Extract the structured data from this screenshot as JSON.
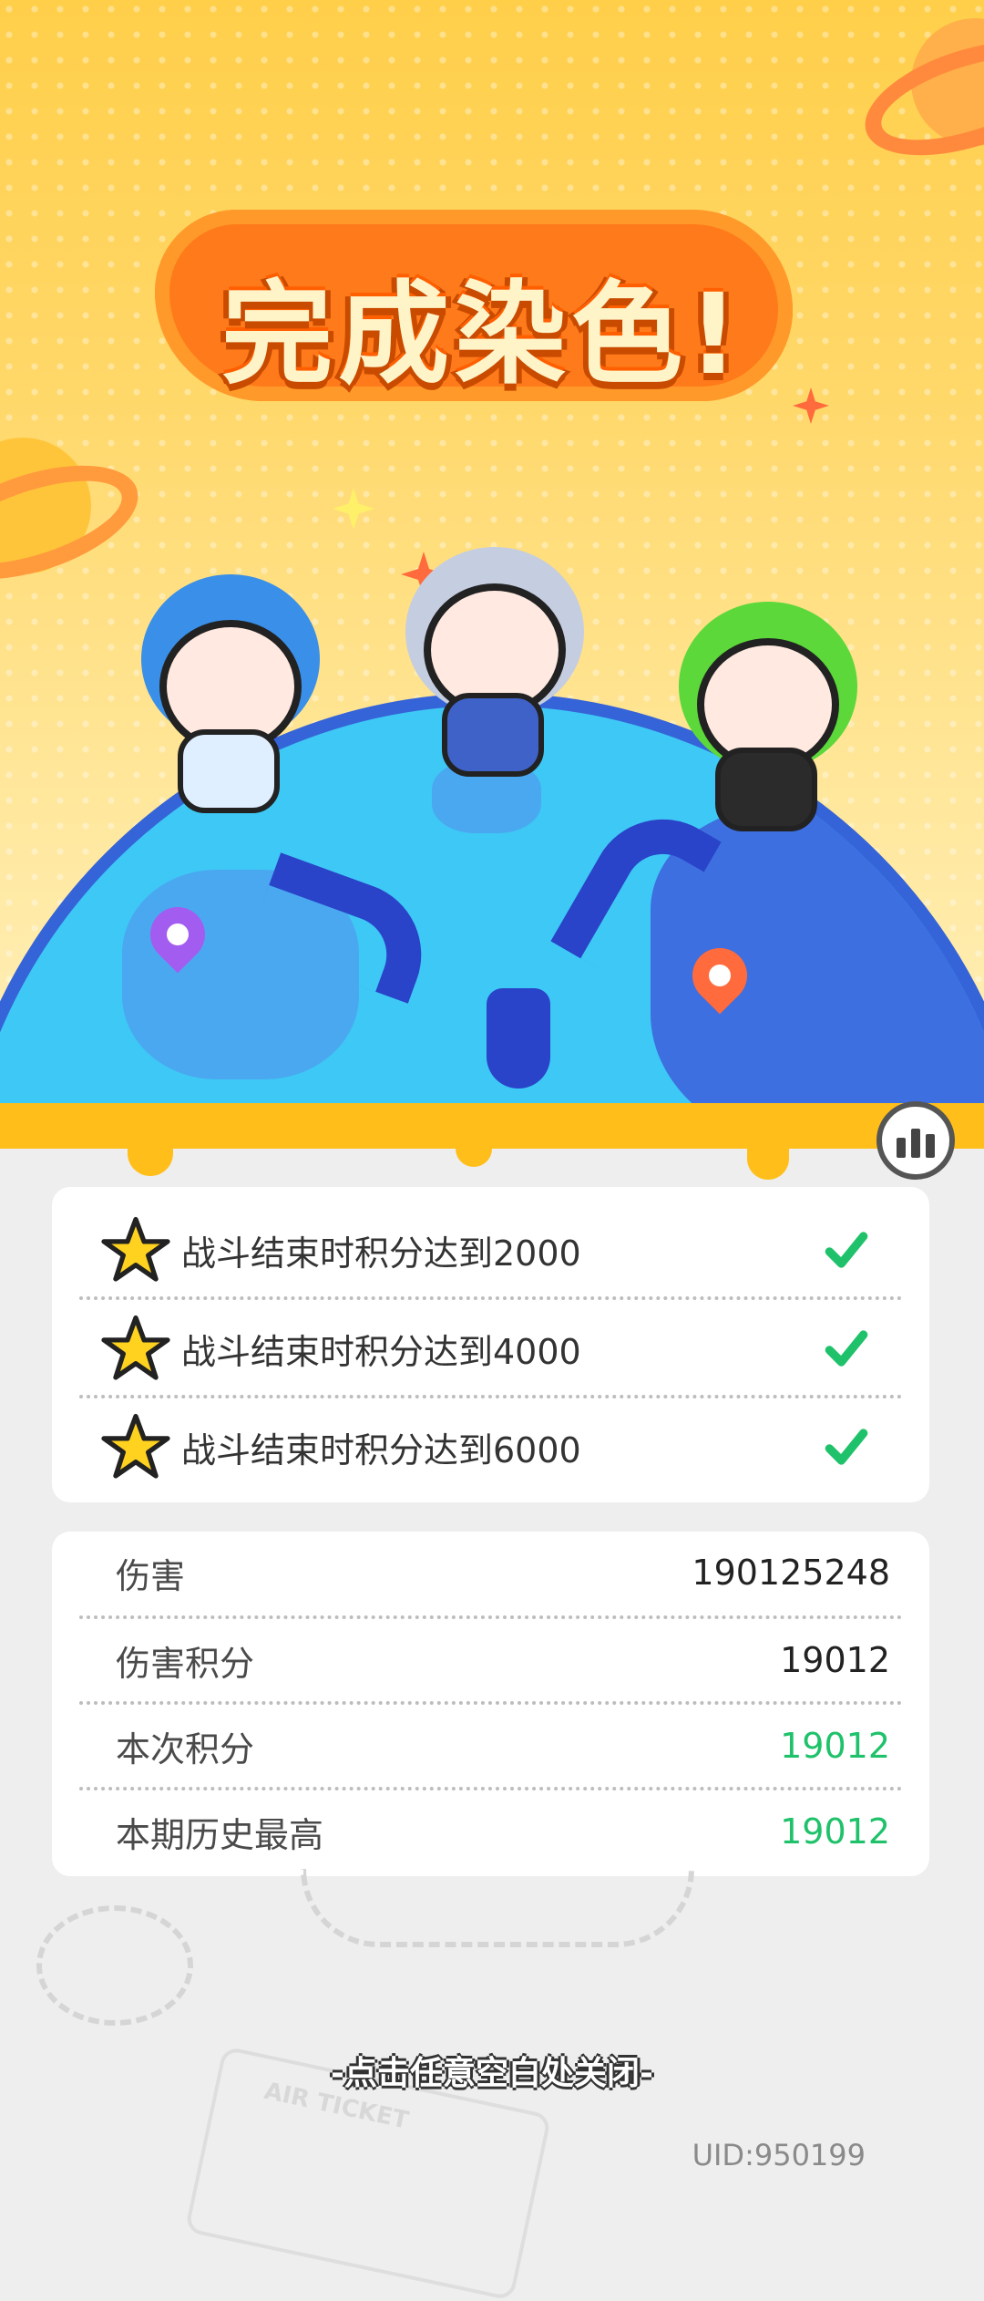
{
  "header": {
    "title": "完成染色!"
  },
  "tasks": [
    {
      "label": "战斗结束时积分达到2000",
      "completed": true
    },
    {
      "label": "战斗结束时积分达到4000",
      "completed": true
    },
    {
      "label": "战斗结束时积分达到6000",
      "completed": true
    }
  ],
  "stats": [
    {
      "label": "伤害",
      "value": "190125248"
    },
    {
      "label": "伤害积分",
      "value": "19012"
    },
    {
      "label": "本次积分",
      "value": "19012"
    },
    {
      "label": "本期历史最高",
      "value": "19012"
    }
  ],
  "footer": {
    "close_hint": "-点击任意空白处关闭-",
    "uid": "UID:950199",
    "ticket_text": "AIR TICKET"
  },
  "colors": {
    "accent_orange": "#ff7a1a",
    "success_green": "#1fc26a",
    "globe_blue": "#3ec8f5"
  },
  "icons": [
    "star-icon",
    "check-icon",
    "ranking-icon",
    "location-pin-icon"
  ]
}
